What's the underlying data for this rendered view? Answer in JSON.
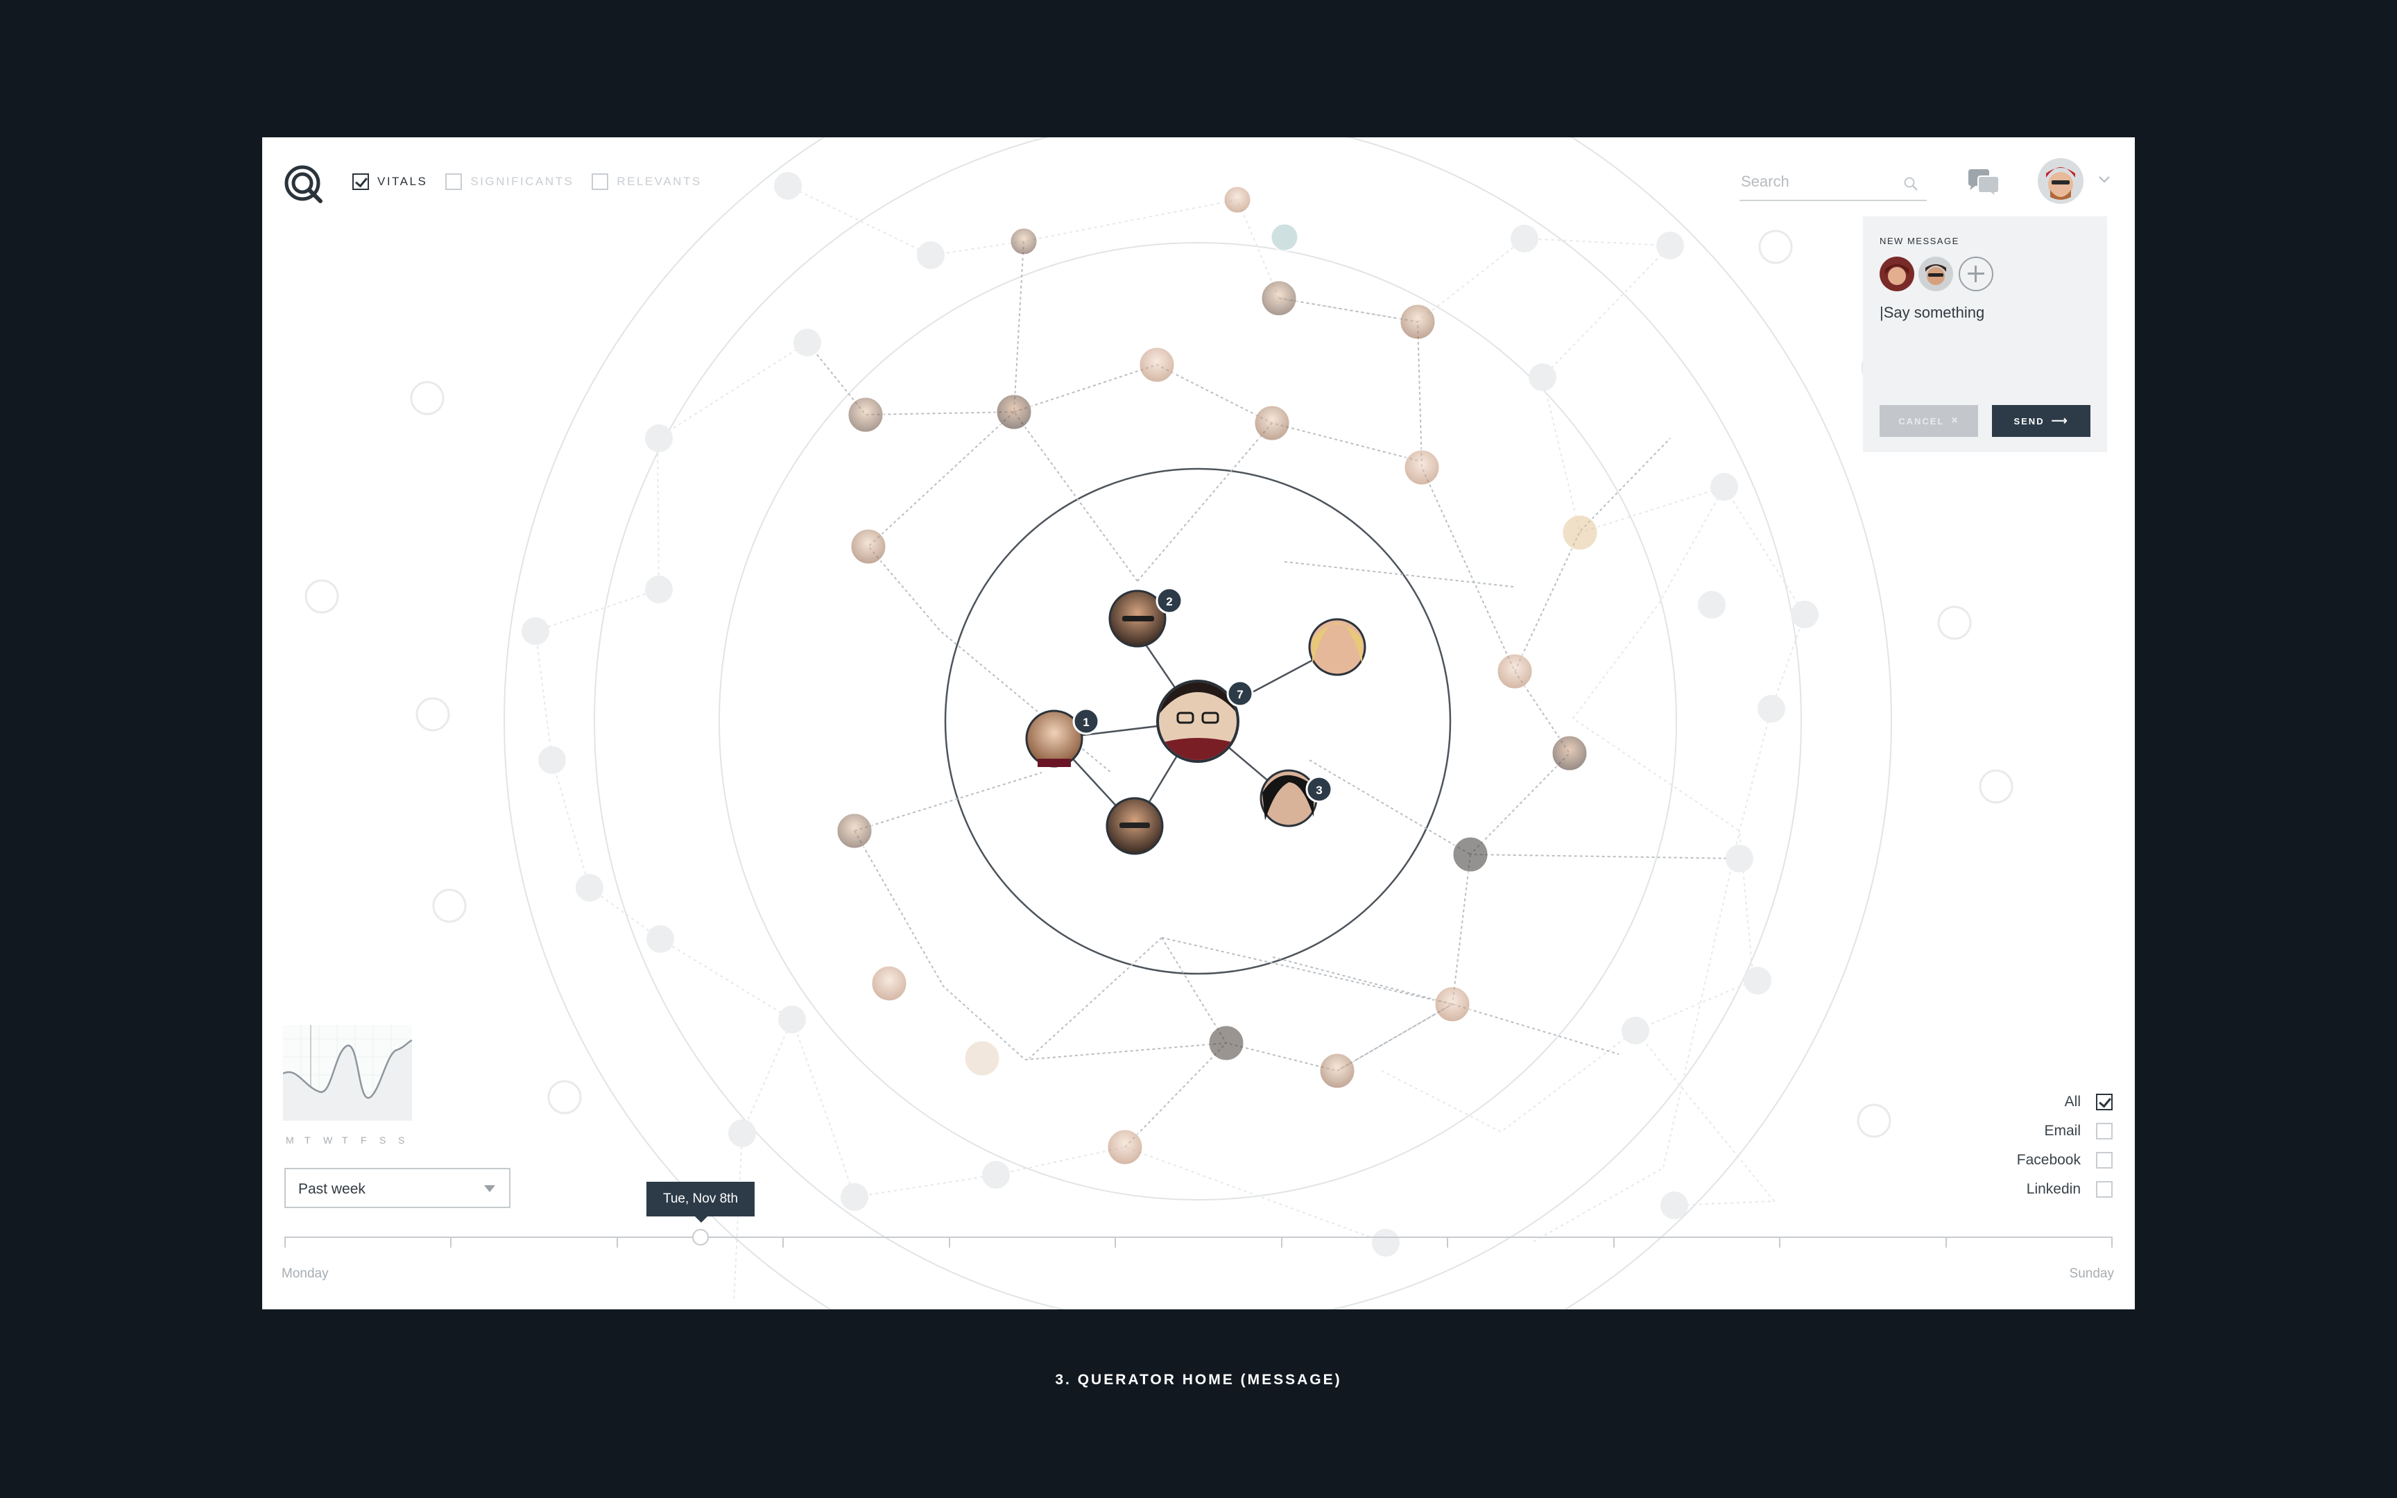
{
  "app": {
    "filters": [
      {
        "label": "VITALS",
        "checked": true
      },
      {
        "label": "SIGNIFICANTS",
        "checked": false
      },
      {
        "label": "RELEVANTS",
        "checked": false
      }
    ],
    "search_placeholder": "Search"
  },
  "message": {
    "title": "NEW MESSAGE",
    "text": "|Say something",
    "cancel_label": "CANCEL",
    "cancel_icon": "×",
    "send_label": "SEND",
    "send_icon": "⟶"
  },
  "graph": {
    "badges": {
      "center": "7",
      "top": "2",
      "left": "1",
      "right": "3"
    }
  },
  "mini_chart": {
    "days": [
      "M",
      "T",
      "W",
      "T",
      "F",
      "S",
      "S"
    ]
  },
  "period_select": {
    "value": "Past week"
  },
  "timeline": {
    "tooltip": "Tue, Nov 8th",
    "start_label": "Monday",
    "end_label": "Sunday"
  },
  "channels": [
    {
      "label": "All",
      "checked": true
    },
    {
      "label": "Email",
      "checked": false
    },
    {
      "label": "Facebook",
      "checked": false
    },
    {
      "label": "Linkedin",
      "checked": false
    }
  ],
  "caption": "3. QUERATOR HOME (MESSAGE)",
  "colors": {
    "page_bg": "#111820",
    "app_bg": "#ffffff",
    "accent_dark": "#2d3b48",
    "ring_core": "#4d545b"
  }
}
